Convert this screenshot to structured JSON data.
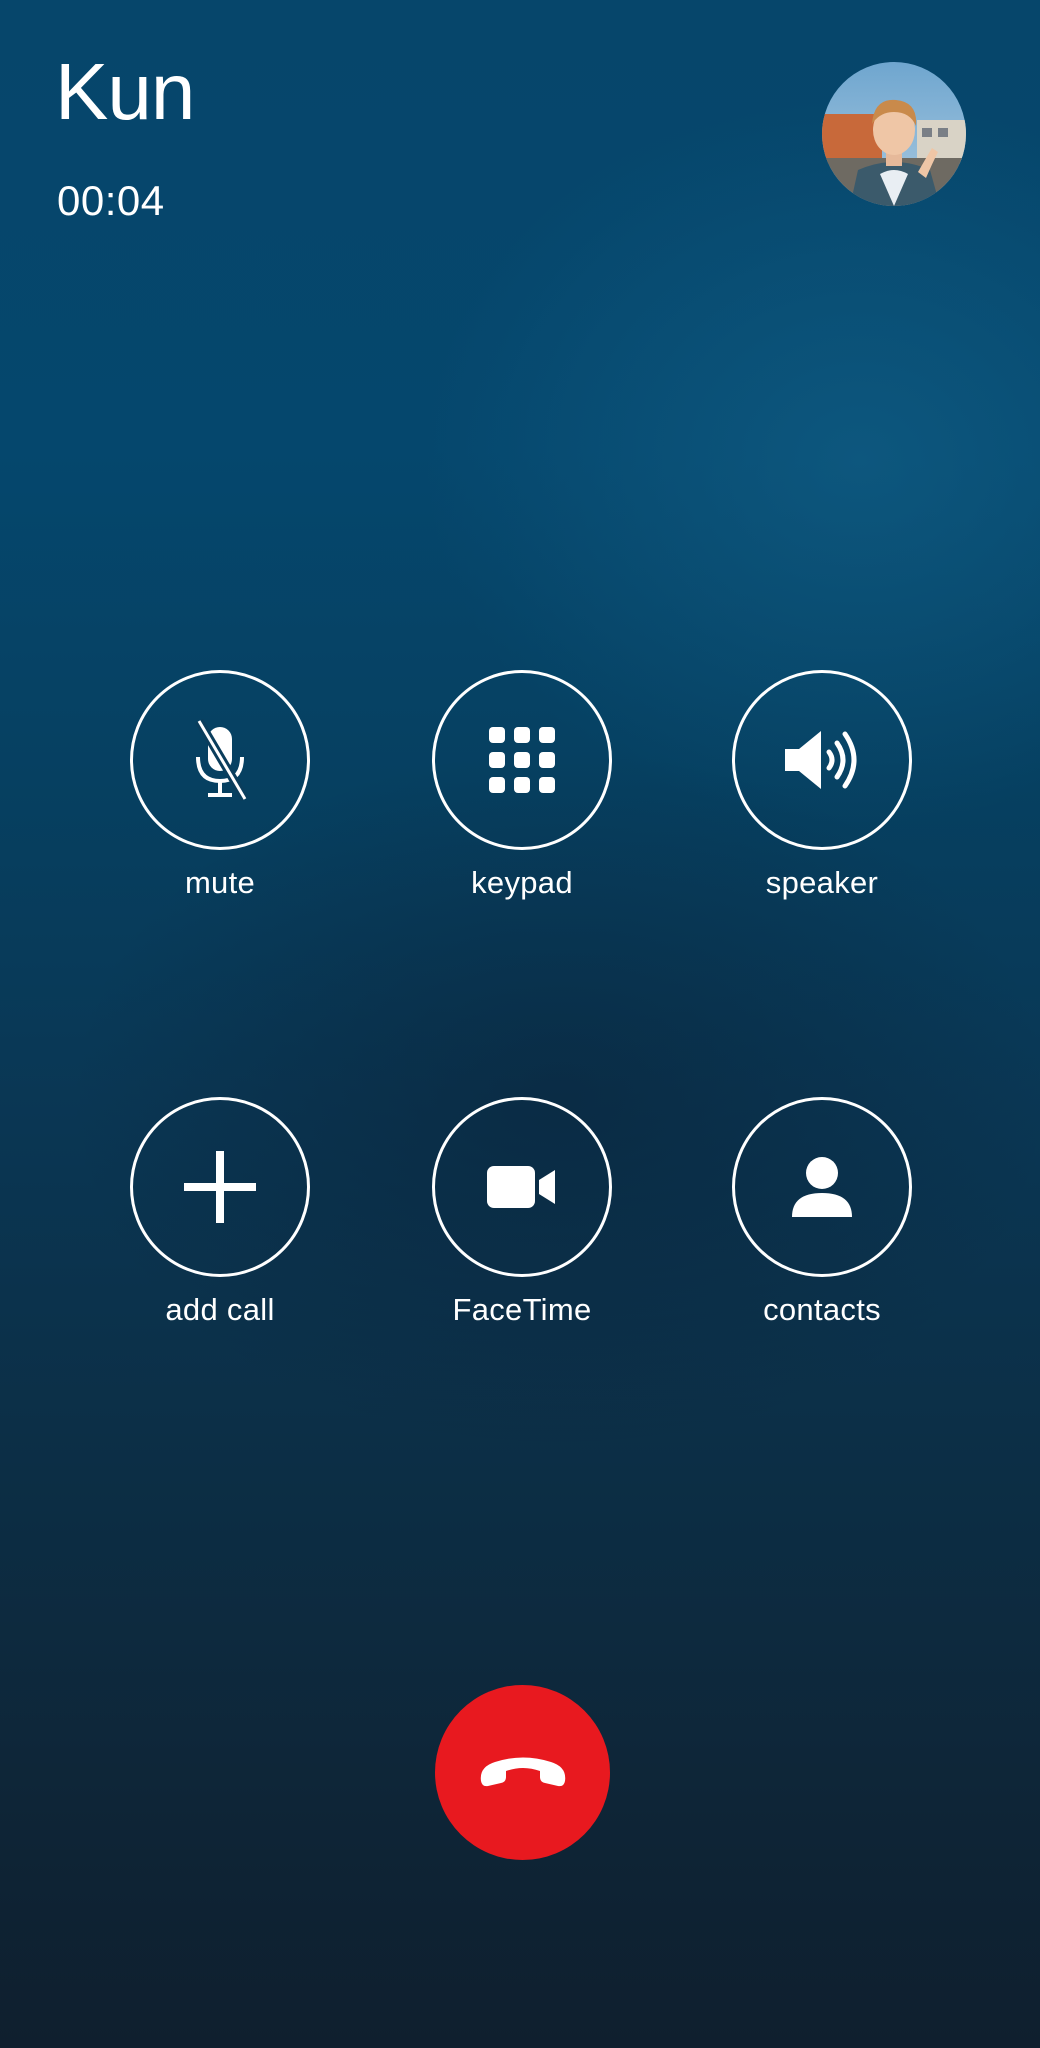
{
  "call": {
    "caller_name": "Kun",
    "duration": "00:04"
  },
  "controls": [
    {
      "id": "mute",
      "label": "mute",
      "icon": "mic-slash-icon"
    },
    {
      "id": "keypad",
      "label": "keypad",
      "icon": "keypad-grid-icon"
    },
    {
      "id": "speaker",
      "label": "speaker",
      "icon": "speaker-icon"
    },
    {
      "id": "add-call",
      "label": "add call",
      "icon": "plus-icon"
    },
    {
      "id": "facetime",
      "label": "FaceTime",
      "icon": "video-camera-icon"
    },
    {
      "id": "contacts",
      "label": "contacts",
      "icon": "person-icon"
    }
  ],
  "end_call": {
    "icon": "phone-hangup-icon",
    "color": "#e8191f"
  },
  "colors": {
    "background_top": "#06466b",
    "background_bottom": "#0f1f2e",
    "foreground": "#ffffff"
  }
}
